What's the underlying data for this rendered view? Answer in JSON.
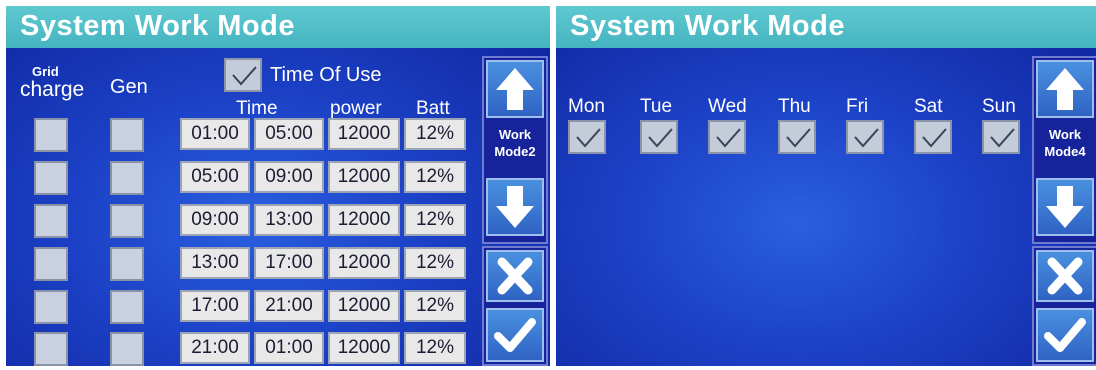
{
  "left": {
    "title": "System Work Mode",
    "grid_label": "Grid",
    "charge_label": "charge",
    "gen_label": "Gen",
    "tou_label": "Time Of Use",
    "col_time": "Time",
    "col_power": "power",
    "col_batt": "Batt",
    "rows": [
      {
        "start": "01:00",
        "end": "05:00",
        "power": "12000",
        "batt": "12%"
      },
      {
        "start": "05:00",
        "end": "09:00",
        "power": "12000",
        "batt": "12%"
      },
      {
        "start": "09:00",
        "end": "13:00",
        "power": "12000",
        "batt": "12%"
      },
      {
        "start": "13:00",
        "end": "17:00",
        "power": "12000",
        "batt": "12%"
      },
      {
        "start": "17:00",
        "end": "21:00",
        "power": "12000",
        "batt": "12%"
      },
      {
        "start": "21:00",
        "end": "01:00",
        "power": "12000",
        "batt": "12%"
      }
    ],
    "work_mode_line1": "Work",
    "work_mode_line2": "Mode2"
  },
  "right": {
    "title": "System Work Mode",
    "days": [
      "Mon",
      "Tue",
      "Wed",
      "Thu",
      "Fri",
      "Sat",
      "Sun"
    ],
    "work_mode_line1": "Work",
    "work_mode_line2": "Mode4"
  },
  "icons": {
    "up": "arrow-up-icon",
    "down": "arrow-down-icon",
    "cancel": "close-icon",
    "confirm": "check-icon",
    "checkbox": "check-icon"
  },
  "colors": {
    "title_bar": "#4fbec8",
    "screen_bg": "#1f46c8",
    "button": "#3a7ad6",
    "cell_bg": "#e8e8e8"
  }
}
